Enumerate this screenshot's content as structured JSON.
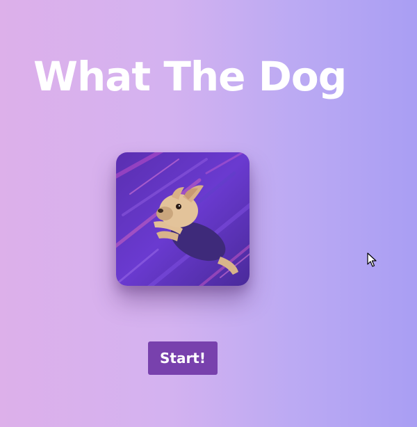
{
  "app": {
    "title": "What The Dog"
  },
  "hero": {
    "image_icon": "flying-dog-image",
    "accent_color": "#7841ad"
  },
  "actions": {
    "start_label": "Start!"
  },
  "colors": {
    "background_left": "#ddb0ea",
    "background_right": "#a99ef3",
    "button": "#7841ad",
    "title_text": "#ffffff"
  }
}
